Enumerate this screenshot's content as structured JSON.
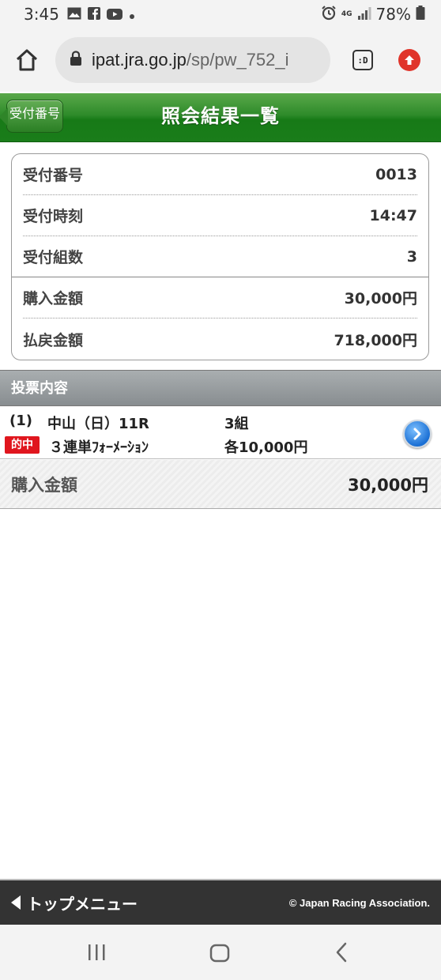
{
  "status_bar": {
    "time": "3:45",
    "network": "4G",
    "battery": "78%",
    "icons": [
      "gallery-icon",
      "facebook-icon",
      "youtube-icon",
      "dot-icon",
      "alarm-icon",
      "signal-icon",
      "battery-icon"
    ]
  },
  "browser": {
    "url_host": "ipat.jra.go.jp",
    "url_path": "/sp/pw_752_i",
    "tab_label": ":D"
  },
  "header": {
    "back_label": "受付番号",
    "title": "照会結果一覧",
    "accent": "#1a7d1a"
  },
  "summary": {
    "rows": [
      {
        "label": "受付番号",
        "value": "0013"
      },
      {
        "label": "受付時刻",
        "value": "14:47"
      },
      {
        "label": "受付組数",
        "value": "3"
      },
      {
        "label": "購入金額",
        "value": "30,000円"
      },
      {
        "label": "払戻金額",
        "value": "718,000円"
      }
    ]
  },
  "votes": {
    "section_title": "投票内容",
    "items": [
      {
        "index": "(1)",
        "race": "中山（日）11R",
        "count": "3組",
        "badge": "的中",
        "bet_type": "３連単ﾌｫｰﾒｰｼｮﾝ",
        "amount": "各10,000円"
      }
    ]
  },
  "total": {
    "label": "購入金額",
    "value": "30,000円"
  },
  "footer": {
    "menu_label": "トップメニュー",
    "copyright": "© Japan Racing Association."
  }
}
